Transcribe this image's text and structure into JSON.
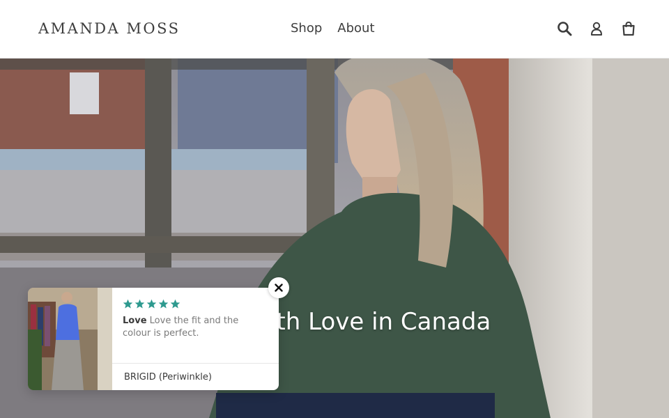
{
  "header": {
    "logo_text": "AMANDA MOSS",
    "nav": [
      {
        "label": "Shop"
      },
      {
        "label": "About"
      }
    ],
    "icons": [
      "search-icon",
      "account-icon",
      "cart-icon"
    ]
  },
  "hero": {
    "title": "Made with Love in Canada",
    "image_subject": "woman in green turtleneck by a window"
  },
  "review_popup": {
    "rating": 5,
    "rating_max": 5,
    "star_color": "#2e9a8f",
    "title": "Love",
    "text": "Love the fit and the colour is perfect.",
    "product": "BRIGID (Periwinkle)",
    "close_icon": "close-icon"
  }
}
